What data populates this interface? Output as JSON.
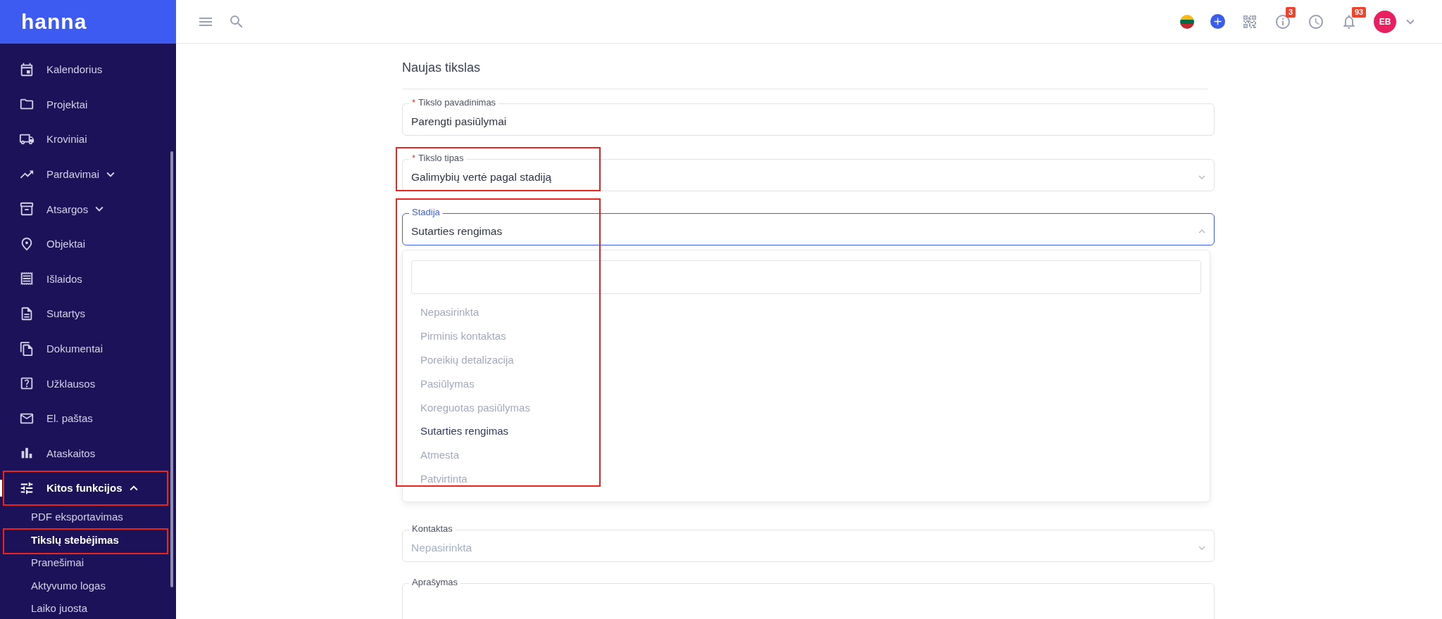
{
  "logo": "hanna",
  "sidebar": {
    "items": [
      {
        "label": "Kalendorius",
        "selected": false,
        "highlighted": false
      },
      {
        "label": "Projektai",
        "selected": false,
        "highlighted": false
      },
      {
        "label": "Kroviniai",
        "selected": false,
        "highlighted": false
      },
      {
        "label": "Pardavimai",
        "selected": false,
        "highlighted": false,
        "expanded": false
      },
      {
        "label": "Atsargos",
        "selected": false,
        "highlighted": false,
        "expanded": false
      },
      {
        "label": "Objektai",
        "selected": false,
        "highlighted": false
      },
      {
        "label": "Išlaidos",
        "selected": false,
        "highlighted": false
      },
      {
        "label": "Sutartys",
        "selected": false,
        "highlighted": false
      },
      {
        "label": "Dokumentai",
        "selected": false,
        "highlighted": false
      },
      {
        "label": "Užklausos",
        "selected": false,
        "highlighted": false
      },
      {
        "label": "El. paštas",
        "selected": false,
        "highlighted": false
      },
      {
        "label": "Ataskaitos",
        "selected": false,
        "highlighted": false
      },
      {
        "label": "Kitos funkcijos",
        "selected": true,
        "highlighted": true,
        "expanded": true,
        "children": [
          {
            "label": "PDF eksportavimas",
            "selected": false,
            "highlighted": false
          },
          {
            "label": "Tikslų stebėjimas",
            "selected": true,
            "highlighted": true
          },
          {
            "label": "Pranešimai",
            "selected": false,
            "highlighted": false
          },
          {
            "label": "Aktyvumo logas",
            "selected": false,
            "highlighted": false
          },
          {
            "label": "Laiko juosta",
            "selected": false,
            "highlighted": false
          }
        ]
      }
    ]
  },
  "topbar": {
    "info_badge": "3",
    "notifications_badge": "93",
    "avatar": "EB"
  },
  "form": {
    "title": "Naujas tikslas",
    "fields": [
      {
        "kind": "text",
        "label": "Tikslo pavadinimas",
        "required_mark": "*",
        "value": "Parengti pasiūlymai",
        "highlighted": false
      },
      {
        "kind": "select",
        "label": "Tikslo tipas",
        "required_mark": "*",
        "value": "Galimybių vertė pagal stadiją",
        "highlighted": true,
        "expanded": false
      },
      {
        "kind": "select",
        "label": "Stadija",
        "value": "Sutarties rengimas",
        "highlighted": true,
        "expanded": true,
        "options": [
          {
            "label": "Nepasirinkta",
            "selected": false
          },
          {
            "label": "Pirminis kontaktas",
            "selected": false
          },
          {
            "label": "Poreikių detalizacija",
            "selected": false
          },
          {
            "label": "Pasiūlymas",
            "selected": false
          },
          {
            "label": "Koreguotas pasiūlymas",
            "selected": false
          },
          {
            "label": "Sutarties rengimas",
            "selected": true
          },
          {
            "label": "Atmesta",
            "selected": false
          },
          {
            "label": "Patvirtinta",
            "selected": false
          }
        ]
      },
      {
        "kind": "select",
        "label": "Kontaktas",
        "placeholder": "Nepasirinkta",
        "highlighted": false,
        "expanded": false
      },
      {
        "kind": "textarea",
        "label": "Aprašymas",
        "highlighted": false
      }
    ]
  }
}
